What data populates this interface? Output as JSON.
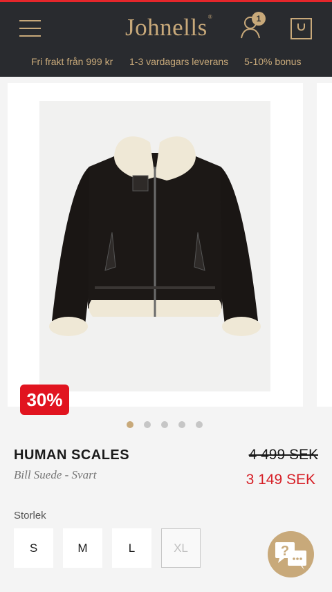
{
  "header": {
    "logo": "Johnells",
    "logo_mark": "®",
    "cart_badge": "1",
    "usps": [
      "Fri frakt från 999 kr",
      "1-3 vardagars leverans",
      "5-10% bonus"
    ]
  },
  "gallery": {
    "discount_badge": "30%",
    "slide_count": 5,
    "active_slide": 1
  },
  "product": {
    "brand": "HUMAN SCALES",
    "model": "Bill Suede - Svart",
    "old_price": "4 499 SEK",
    "price": "3 149 SEK"
  },
  "sizes": {
    "label": "Storlek",
    "options": [
      "S",
      "M",
      "L",
      "XL"
    ],
    "unavailable": [
      "XL"
    ]
  },
  "colors": {
    "accent": "#c8a97a",
    "header_bg": "#292b2f",
    "sale": "#d61f26",
    "badge_red": "#e1141f"
  },
  "icons": [
    "menu-icon",
    "account-icon",
    "shopping-bag-icon",
    "chat-help-icon"
  ]
}
